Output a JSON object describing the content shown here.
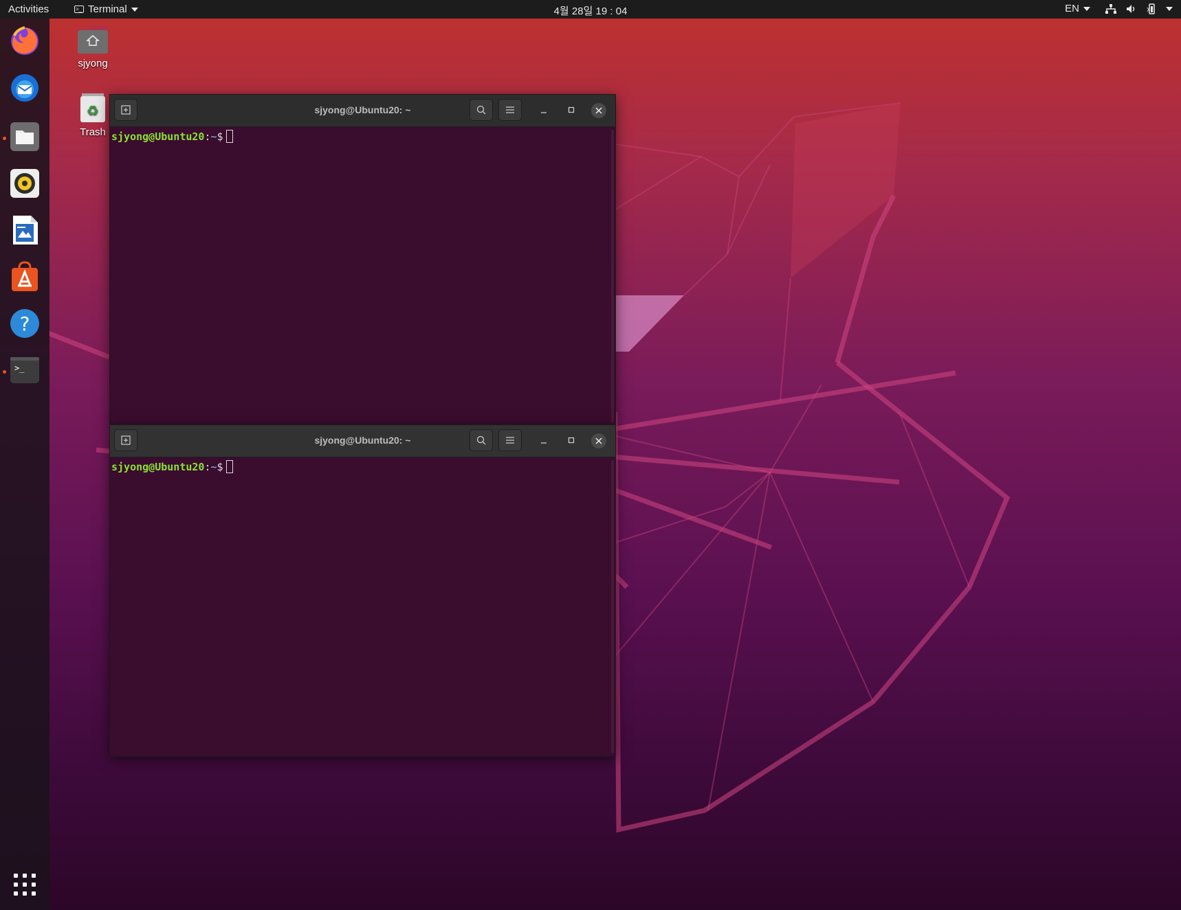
{
  "topbar": {
    "activities": "Activities",
    "app_menu": "Terminal",
    "clock": "4월 28일  19 : 04",
    "input_source": "EN"
  },
  "desktop": {
    "home_label": "sjyong",
    "trash_label": "Trash"
  },
  "dock": {
    "apps": [
      "firefox-icon",
      "thunderbird-icon",
      "files-icon",
      "rhythmbox-icon",
      "writer-icon",
      "software-icon",
      "help-icon",
      "terminal-icon"
    ],
    "show_apps": "grid-icon"
  },
  "windows": [
    {
      "title": "sjyong@Ubuntu20: ~",
      "prompt_user": "sjyong@Ubuntu20",
      "prompt_sep": ":",
      "prompt_path": "~",
      "prompt_symbol": "$"
    },
    {
      "title": "sjyong@Ubuntu20: ~",
      "prompt_user": "sjyong@Ubuntu20",
      "prompt_sep": ":",
      "prompt_path": "~",
      "prompt_symbol": "$"
    }
  ],
  "colors": {
    "accent": "#e95420",
    "terminal_bg": "#300a24",
    "prompt_user": "#8ae234",
    "prompt_path": "#729fcf"
  }
}
